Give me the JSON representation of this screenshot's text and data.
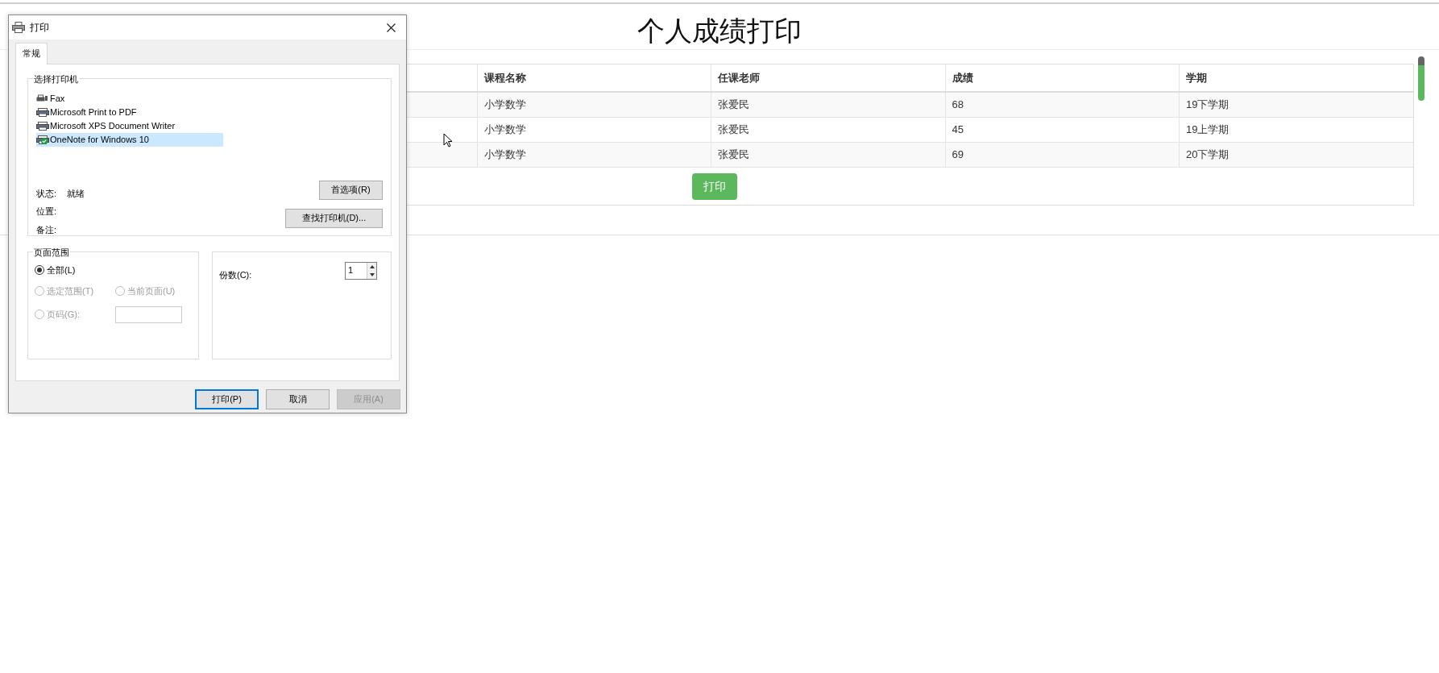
{
  "page": {
    "title": "个人成绩打印",
    "table": {
      "columns": [
        "课程名称",
        "任课老师",
        "成绩",
        "学期"
      ],
      "rows": [
        {
          "cells": [
            "小学数学",
            "张爱民",
            "68",
            "19下学期"
          ]
        },
        {
          "cells": [
            "小学数学",
            "张爱民",
            "45",
            "19上学期"
          ]
        },
        {
          "cells": [
            "小学数学",
            "张爱民",
            "69",
            "20下学期"
          ]
        }
      ]
    },
    "print_button": "打印"
  },
  "dialog": {
    "title": "打印",
    "tabs": [
      {
        "label": "常规",
        "selected": true
      }
    ],
    "printer_group": {
      "label": "选择打印机",
      "printers": [
        {
          "name": "Fax",
          "kind": "fax",
          "selected": false,
          "is_default": false
        },
        {
          "name": "Microsoft Print to PDF",
          "kind": "printer",
          "selected": false,
          "is_default": false
        },
        {
          "name": "Microsoft XPS Document Writer",
          "kind": "printer",
          "selected": false,
          "is_default": false
        },
        {
          "name": "OneNote for Windows 10",
          "kind": "printer",
          "selected": true,
          "is_default": true
        }
      ],
      "info": [
        {
          "label": "状态:",
          "value": "就绪"
        },
        {
          "label": "位置:"
        },
        {
          "label": "备注:"
        }
      ],
      "buttons": [
        "首选项(R)",
        "查找打印机(D)..."
      ]
    },
    "page_range": {
      "label": "页面范围",
      "options": [
        {
          "label": "全部(L)",
          "selected": true,
          "disabled": false
        },
        {
          "label": "选定范围(T)",
          "selected": false,
          "disabled": true
        },
        {
          "label": "当前页面(U)",
          "selected": false,
          "disabled": true
        },
        {
          "label": "页码(G):",
          "selected": false,
          "disabled": true
        }
      ],
      "page_field": {
        "disabled": true
      }
    },
    "copies": {
      "label": "份数(C):",
      "value": "1"
    },
    "buttons": [
      {
        "label": "打印(P)",
        "default": true,
        "disabled": false
      },
      {
        "label": "取消",
        "default": false,
        "disabled": false
      },
      {
        "label": "应用(A)",
        "default": false,
        "disabled": true
      }
    ]
  }
}
